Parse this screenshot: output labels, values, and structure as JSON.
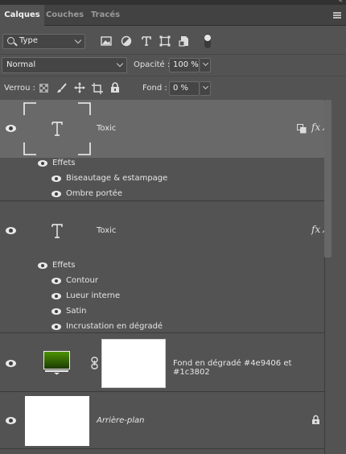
{
  "tabs": [
    {
      "label": "Calques",
      "active": true
    },
    {
      "label": "Couches",
      "active": false
    },
    {
      "label": "Tracés",
      "active": false
    }
  ],
  "filter": {
    "kind_label": "Type",
    "icons": [
      "image-filter-icon",
      "adjustment-filter-icon",
      "text-filter-icon",
      "shape-filter-icon",
      "smart-object-filter-icon",
      "filter-toggle-icon"
    ]
  },
  "blend": {
    "mode": "Normal",
    "opacity_label": "Opacité :",
    "opacity_value": "100 %"
  },
  "lock": {
    "label": "Verrou :",
    "icons": [
      "lock-transparency-icon",
      "lock-brush-icon",
      "lock-move-icon",
      "lock-artboard-icon",
      "lock-all-icon"
    ],
    "fill_label": "Fond :",
    "fill_value": "0 %"
  },
  "layers": [
    {
      "name": "Toxic",
      "type": "text",
      "selected": true,
      "effects_label": "Effets",
      "effects": [
        "Biseautage & estampage",
        "Ombre portée"
      ]
    },
    {
      "name": "Toxic",
      "type": "text",
      "selected": false,
      "effects_label": "Effets",
      "effects": [
        "Contour",
        "Lueur interne",
        "Satin",
        "Incrustation en dégradé"
      ]
    },
    {
      "name": "Fond en dégradé #4e9406 et #1c3802",
      "type": "gradient-fill",
      "colors": [
        "#4e9406",
        "#1c3802"
      ]
    },
    {
      "name": "Arrière-plan",
      "type": "background",
      "locked": true
    }
  ],
  "colors": {
    "panel": "#535353",
    "selected_row": "#696969",
    "tab_bar": "#424242"
  }
}
